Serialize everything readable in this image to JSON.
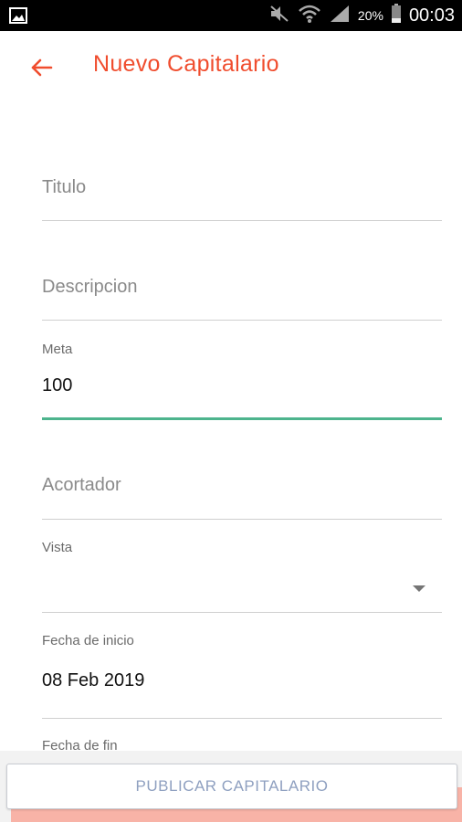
{
  "status_bar": {
    "battery_percent": "20%",
    "time": "00:03",
    "icons": [
      "image-icon",
      "mute-icon",
      "wifi-icon",
      "signal-icon",
      "battery-icon"
    ]
  },
  "app_bar": {
    "title": "Nuevo Capitalario",
    "back_icon": "arrow-left-icon",
    "accent_color": "#F04D2E"
  },
  "form": {
    "titulo": {
      "placeholder": "Titulo"
    },
    "descripcion": {
      "placeholder": "Descripcion"
    },
    "meta": {
      "label": "Meta",
      "value": "100"
    },
    "acortador": {
      "placeholder": "Acortador"
    },
    "vista": {
      "label": "Vista",
      "value": ""
    },
    "fecha_inicio": {
      "label": "Fecha de inicio",
      "value": "08 Feb 2019"
    },
    "fecha_fin": {
      "label": "Fecha de fin"
    }
  },
  "actions": {
    "publish_label": "PUBLICAR CAPITALARIO"
  },
  "colors": {
    "active_underline": "#4DB48D",
    "button_text": "#8fa0c0"
  }
}
